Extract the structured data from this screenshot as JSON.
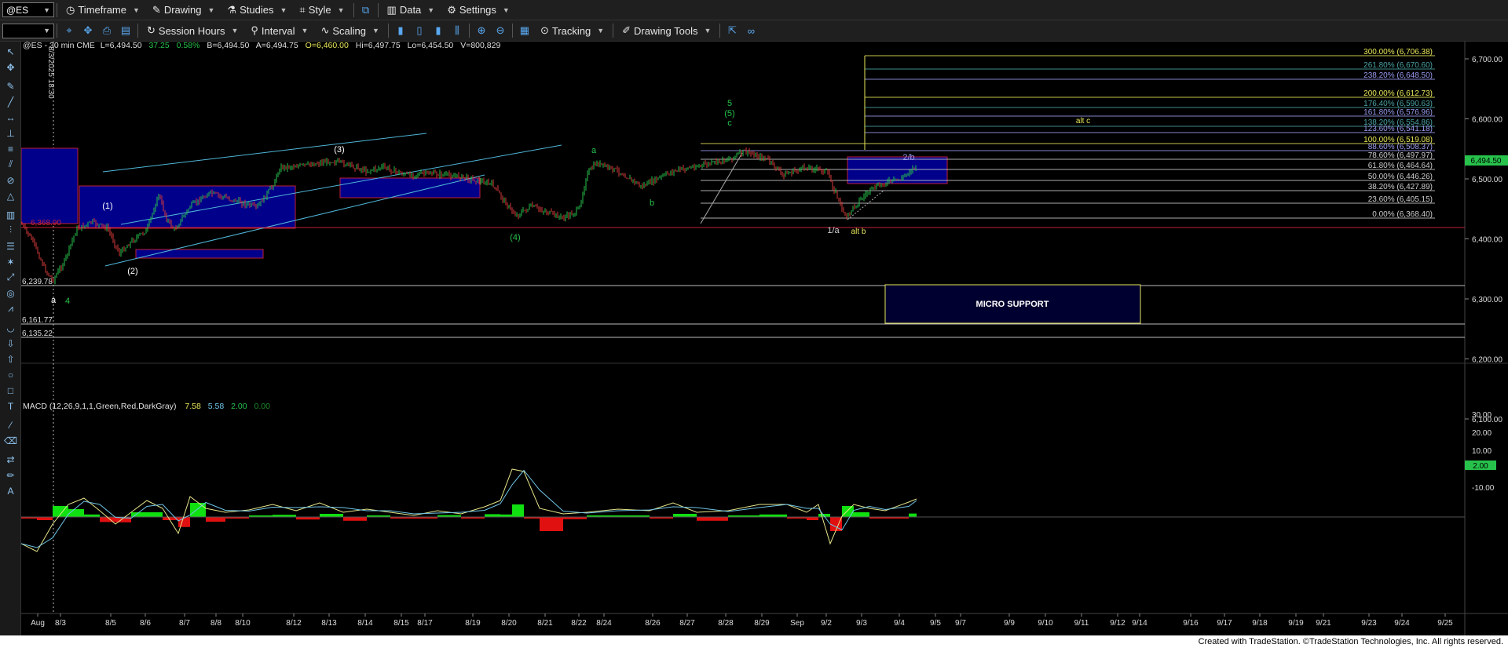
{
  "toolbar": {
    "symbol": "@ES",
    "timeframe": "Timeframe",
    "drawing": "Drawing",
    "studies": "Studies",
    "style": "Style",
    "data": "Data",
    "settings": "Settings",
    "session_hours": "Session Hours",
    "interval": "Interval",
    "scaling": "Scaling",
    "tracking": "Tracking",
    "drawing_tools": "Drawing Tools"
  },
  "chart_header": {
    "symbol_info": "@ES - 30 min  CME",
    "last": "L=6,494.50",
    "change": "37.25",
    "change_pct": "0.58%",
    "bid": "B=6,494.50",
    "ask": "A=6,494.75",
    "open": "O=6,460.00",
    "high": "Hi=6,497.75",
    "low": "Lo=6,454.50",
    "volume": "V=800,829"
  },
  "date_marker": "8/3/2025 18:30",
  "price_axis": {
    "ticks": [
      "6,700.00",
      "6,600.00",
      "6,500.00",
      "6,400.00",
      "6,300.00",
      "6,200.00",
      "6,100.00"
    ],
    "last_price": "6,494.50"
  },
  "macd": {
    "label": "MACD (12,26,9,1,1,Green,Red,DarkGray)",
    "macd_value": "7.58",
    "signal_value": "5.58",
    "diff_value": "2.00",
    "diff_extra": "0.00",
    "axis_ticks": [
      "30.00",
      "20.00",
      "10.00",
      "-10.00"
    ],
    "current": "2.00"
  },
  "date_axis": [
    "Aug",
    "8/3",
    "8/5",
    "8/6",
    "8/7",
    "8/8",
    "8/10",
    "8/12",
    "8/13",
    "8/14",
    "8/15",
    "8/17",
    "8/19",
    "8/20",
    "8/21",
    "8/22",
    "8/24",
    "8/26",
    "8/27",
    "8/28",
    "8/29",
    "Sep",
    "9/2",
    "9/3",
    "9/4",
    "9/5",
    "9/7",
    "9/9",
    "9/10",
    "9/11",
    "9/12",
    "9/14",
    "9/16",
    "9/17",
    "9/18",
    "9/19",
    "9/21",
    "9/23",
    "9/24",
    "9/25"
  ],
  "fib_levels": [
    {
      "label": "300.00% (6,706.38)",
      "color": "#e8e85a"
    },
    {
      "label": "261.80% (6,670.60)",
      "color": "#4aa3a3"
    },
    {
      "label": "238.20% (6,648.50)",
      "color": "#9a9af0"
    },
    {
      "label": "200.00% (6,612.73)",
      "color": "#e8e85a"
    },
    {
      "label": "176.40% (6,590.63)",
      "color": "#4aa3a3"
    },
    {
      "label": "161.80% (6,576.96)",
      "color": "#9a9af0"
    },
    {
      "label": "138.20% (6,554.86)",
      "color": "#4aa3a3"
    },
    {
      "label": "123.60% (6,541.18)",
      "color": "#9a9af0"
    },
    {
      "label": "100.00% (6,519.08)",
      "color": "#e8e85a"
    },
    {
      "label": "88.60% (6,508.37)",
      "color": "#9a9af0"
    },
    {
      "label": "78.60% (6,497.97)",
      "color": "#cccccc"
    },
    {
      "label": "61.80% (6,464.64)",
      "color": "#cccccc"
    },
    {
      "label": "50.00% (6,446.26)",
      "color": "#cccccc"
    },
    {
      "label": "38.20% (6,427.89)",
      "color": "#cccccc"
    },
    {
      "label": "23.60% (6,405.15)",
      "color": "#cccccc"
    },
    {
      "label": "0.00% (6,368.40)",
      "color": "#cccccc"
    }
  ],
  "h_levels": {
    "l1": "6,239.78",
    "l2": "6,161.77",
    "l3": "6,135.22",
    "red_level": "6,368.90"
  },
  "labels": {
    "w1": "(1)",
    "w2": "(2)",
    "w3": "(3)",
    "w4": "(4)",
    "w5": "(5)",
    "a1": "a",
    "a2": "a",
    "b1": "b",
    "c1": "c",
    "five": "5",
    "four": "4",
    "one_a": "1/a",
    "alt_b": "alt b",
    "alt_c": "alt c",
    "two_b": "2/b"
  },
  "micro_support": "MICRO SUPPORT",
  "footer": "Created with TradeStation. ©TradeStation Technologies, Inc. All rights reserved.",
  "colors": {
    "blue_box": "#00008b",
    "red_border": "#c0203a",
    "channel": "#4fb6d8",
    "up_candle": "#27c24c",
    "down_candle": "#d63a3a",
    "macd_line": "#e6e68a",
    "signal_line": "#6fc6e8",
    "hist_pos": "#10e010",
    "hist_neg": "#e01010"
  }
}
